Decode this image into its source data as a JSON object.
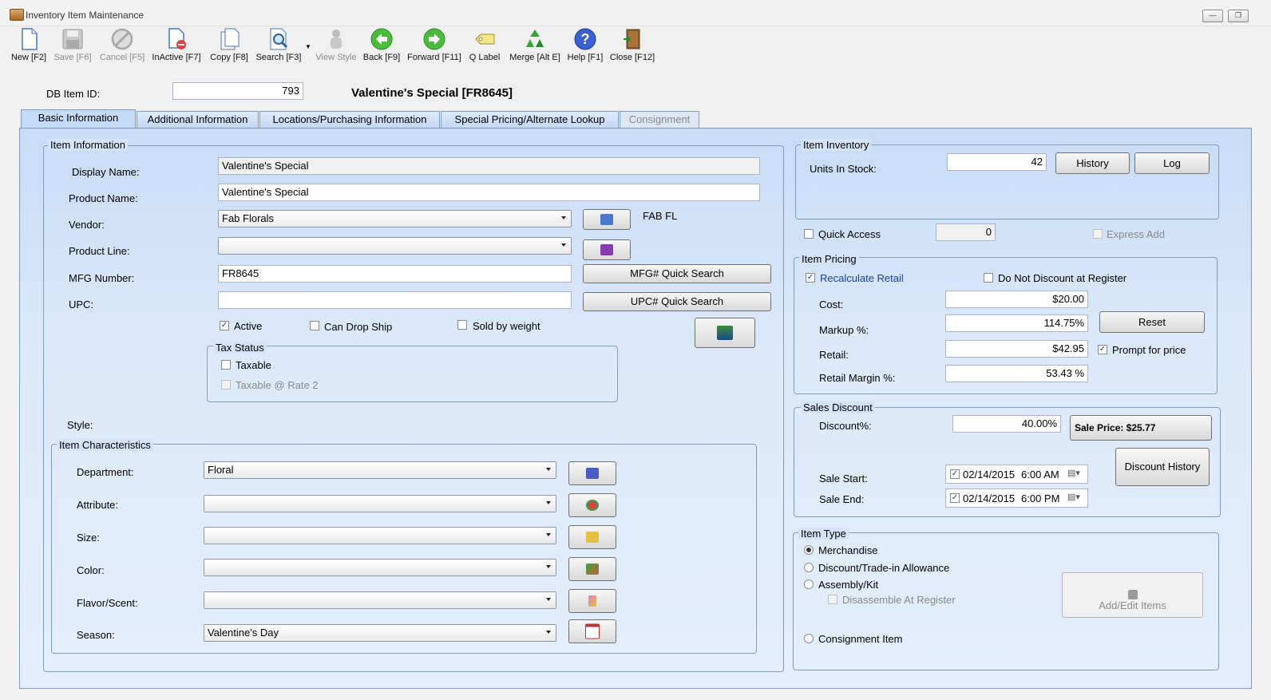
{
  "window": {
    "title": "Inventory Item Maintenance"
  },
  "toolbar": [
    {
      "label": "New [F2]",
      "icon": "new-document-icon",
      "enabled": true
    },
    {
      "label": "Save [F6]",
      "icon": "save-disk-icon",
      "enabled": false
    },
    {
      "label": "Cancel [F5]",
      "icon": "cancel-icon",
      "enabled": false
    },
    {
      "label": "InActive [F7]",
      "icon": "inactive-document-icon",
      "enabled": true
    },
    {
      "label": "Copy [F8]",
      "icon": "copy-icon",
      "enabled": true
    },
    {
      "label": "Search [F3]",
      "icon": "search-icon",
      "enabled": true
    },
    {
      "label": "View Style",
      "icon": "view-style-icon",
      "enabled": false
    },
    {
      "label": "Back [F9]",
      "icon": "back-arrow-icon",
      "enabled": true
    },
    {
      "label": "Forward [F11]",
      "icon": "forward-arrow-icon",
      "enabled": true
    },
    {
      "label": "Q Label",
      "icon": "label-tag-icon",
      "enabled": true
    },
    {
      "label": "Merge [Alt E]",
      "icon": "merge-recycle-icon",
      "enabled": true
    },
    {
      "label": "Help [F1]",
      "icon": "help-icon",
      "enabled": true
    },
    {
      "label": "Close [F12]",
      "icon": "close-door-icon",
      "enabled": true
    }
  ],
  "header": {
    "db_item_label": "DB Item ID:",
    "db_item_id": "793",
    "item_title": "Valentine's Special [FR8645]"
  },
  "tabs": [
    {
      "label": "Basic Information",
      "active": true
    },
    {
      "label": "Additional Information"
    },
    {
      "label": "Locations/Purchasing Information"
    },
    {
      "label": "Special Pricing/Alternate Lookup"
    },
    {
      "label": "Consignment",
      "disabled": true
    }
  ],
  "item_info": {
    "title": "Item Information",
    "display_name_label": "Display Name:",
    "display_name": "Valentine's Special",
    "product_name_label": "Product Name:",
    "product_name": "Valentine's Special",
    "vendor_label": "Vendor:",
    "vendor": "Fab Florals",
    "vendor_code": "FAB FL",
    "product_line_label": "Product Line:",
    "product_line": "",
    "mfg_label": "MFG Number:",
    "mfg_number": "FR8645",
    "upc_label": "UPC:",
    "upc": "",
    "mfg_search": "MFG# Quick Search",
    "upc_search": "UPC# Quick Search",
    "active_label": "Active",
    "drop_ship_label": "Can Drop Ship",
    "sold_by_weight_label": "Sold by weight",
    "tax_title": "Tax Status",
    "taxable_label": "Taxable",
    "taxable_rate2_label": "Taxable @ Rate 2",
    "style_label": "Style:"
  },
  "characteristics": {
    "title": "Item Characteristics",
    "rows": [
      {
        "label": "Department:",
        "value": "Floral",
        "icon": "department-icon"
      },
      {
        "label": "Attribute:",
        "value": "",
        "icon": "attribute-icon"
      },
      {
        "label": "Size:",
        "value": "",
        "icon": "size-icon"
      },
      {
        "label": "Color:",
        "value": "",
        "icon": "color-palette-icon"
      },
      {
        "label": "Flavor/Scent:",
        "value": "",
        "icon": "flavor-icon"
      },
      {
        "label": "Season:",
        "value": "Valentine's Day",
        "icon": "calendar-icon"
      }
    ]
  },
  "inventory": {
    "title": "Item Inventory",
    "units_label": "Units In Stock:",
    "units": "42",
    "history_btn": "History",
    "log_btn": "Log",
    "quick_access_label": "Quick Access",
    "quick_access_value": "0",
    "express_add_label": "Express Add"
  },
  "pricing": {
    "title": "Item Pricing",
    "recalc_label": "Recalculate Retail",
    "no_discount_label": "Do Not Discount at Register",
    "cost_label": "Cost:",
    "cost": "$20.00",
    "markup_label": "Markup %:",
    "markup": "114.75%",
    "retail_label": "Retail:",
    "retail": "$42.95",
    "margin_label": "Retail Margin %:",
    "margin": "53.43 %",
    "reset_btn": "Reset",
    "prompt_label": "Prompt for price"
  },
  "sales_discount": {
    "title": "Sales Discount",
    "discount_label": "Discount%:",
    "discount": "40.00%",
    "sale_price": "Sale Price: $25.77",
    "start_label": "Sale Start:",
    "start_date": "02/14/2015",
    "start_time": "6:00 AM",
    "end_label": "Sale End:",
    "end_date": "02/14/2015",
    "end_time": "6:00 PM",
    "history_btn": "Discount History"
  },
  "item_type": {
    "title": "Item Type",
    "merchandise": "Merchandise",
    "discount": "Discount/Trade-in Allowance",
    "assembly": "Assembly/Kit",
    "disassemble": "Disassemble At Register",
    "consignment": "Consignment Item",
    "add_edit_btn": "Add/Edit Items"
  }
}
